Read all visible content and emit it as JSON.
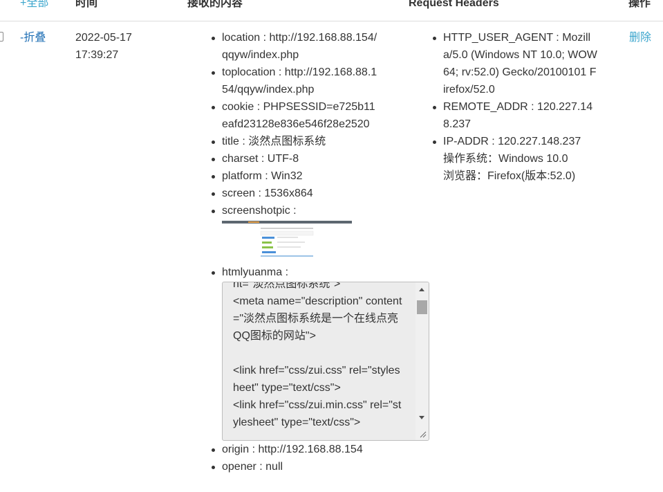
{
  "header": {
    "expand_all": "+全部",
    "time": "时间",
    "content": "接收的内容",
    "request_headers": "Request Headers",
    "action": "操作"
  },
  "row": {
    "collapse": "-折叠",
    "date": "2022-05-17",
    "time": "17:39:27",
    "delete": "删除",
    "content": {
      "location": "location : http://192.168.88.154/qqyw/index.php",
      "toplocation": "toplocation : http://192.168.88.154/qqyw/index.php",
      "cookie": "cookie : PHPSESSID=e725b11eafd23128e836e546f28e2520",
      "title": "title : 淡然点图标系统",
      "charset": "charset : UTF-8",
      "platform": "platform : Win32",
      "screen": "screen : 1536x864",
      "screenshotpic": "screenshotpic :",
      "htmlyuanma": "htmlyuanma :",
      "htmlyuanma_source": "nt=\"淡然点图标系统\">\n<meta name=\"description\" content=\"淡然点图标系统是一个在线点亮QQ图标的网站\">\n\n<link href=\"css/zui.css\" rel=\"stylesheet\" type=\"text/css\">\n<link href=\"css/zui.min.css\" rel=\"stylesheet\" type=\"text/css\">",
      "origin": "origin : http://192.168.88.154",
      "opener": "opener : null"
    },
    "headers": {
      "user_agent": "HTTP_USER_AGENT : Mozilla/5.0 (Windows NT 10.0; WOW64; rv:52.0) Gecko/20100101 Firefox/52.0",
      "remote_addr": "REMOTE_ADDR : 120.227.148.237",
      "ip_addr": "IP-ADDR : 120.227.148.237",
      "os": "操作系统：Windows 10.0",
      "browser": "浏览器：Firefox(版本:52.0)"
    }
  }
}
